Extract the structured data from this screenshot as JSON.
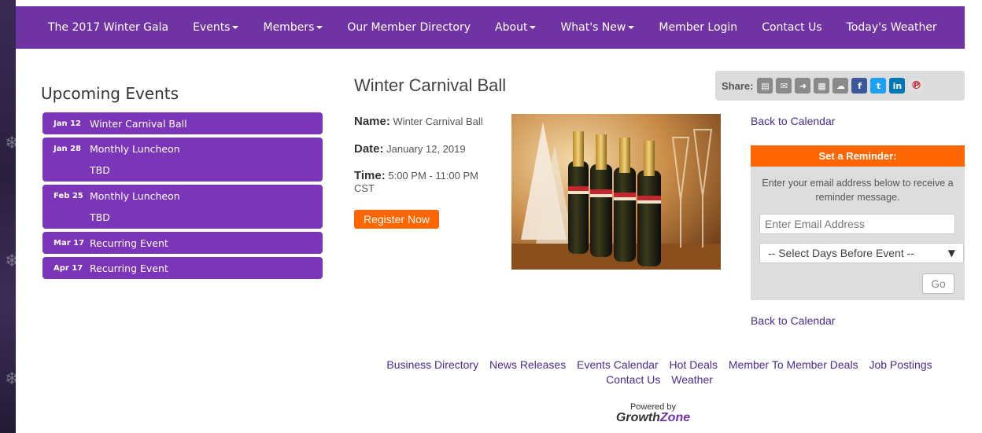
{
  "nav": {
    "items": [
      {
        "label": "The 2017 Winter Gala",
        "dropdown": false
      },
      {
        "label": "Events",
        "dropdown": true
      },
      {
        "label": "Members",
        "dropdown": true
      },
      {
        "label": "Our Member Directory",
        "dropdown": false
      },
      {
        "label": "About",
        "dropdown": true
      },
      {
        "label": "What's New",
        "dropdown": true
      },
      {
        "label": "Member Login",
        "dropdown": false
      },
      {
        "label": "Contact Us",
        "dropdown": false
      },
      {
        "label": "Today's Weather",
        "dropdown": false
      }
    ]
  },
  "upcoming": {
    "title": "Upcoming Events",
    "events": [
      {
        "date": "Jan 12",
        "name": "Winter Carnival Ball",
        "sub": ""
      },
      {
        "date": "Jan 28",
        "name": "Monthly Luncheon",
        "sub": "TBD"
      },
      {
        "date": "Feb 25",
        "name": "Monthly Luncheon",
        "sub": "TBD"
      },
      {
        "date": "Mar 17",
        "name": "Recurring Event",
        "sub": ""
      },
      {
        "date": "Apr 17",
        "name": "Recurring Event",
        "sub": ""
      }
    ]
  },
  "event": {
    "title": "Winter Carnival Ball",
    "name_label": "Name:",
    "name_value": "Winter Carnival Ball",
    "date_label": "Date:",
    "date_value": "January 12, 2019",
    "time_label": "Time:",
    "time_value": "5:00 PM - 11:00 PM",
    "time_zone": "CST",
    "register_label": "Register Now"
  },
  "share": {
    "label": "Share:",
    "icons": [
      "print-icon",
      "email-icon",
      "share-icon",
      "calendar-icon",
      "cloud-icon",
      "facebook-icon",
      "twitter-icon",
      "linkedin-icon",
      "pinterest-icon"
    ]
  },
  "sidebar": {
    "back_label": "Back to Calendar"
  },
  "reminder": {
    "title": "Set a Reminder:",
    "text": "Enter your email address below to receive a reminder message.",
    "email_placeholder": "Enter Email Address",
    "select_value": "-- Select Days Before Event --",
    "go_label": "Go"
  },
  "footer": {
    "links": [
      "Business Directory",
      "News Releases",
      "Events Calendar",
      "Hot Deals",
      "Member To Member Deals",
      "Job Postings",
      "Contact Us",
      "Weather"
    ],
    "powered_by": "Powered by",
    "brand_part1": "Growth",
    "brand_part2": "Zone"
  },
  "colors": {
    "nav_bg": "#6f33a3",
    "event_bg": "#7b35b8",
    "accent_orange": "#ff6600",
    "link": "#4a2c8c"
  }
}
